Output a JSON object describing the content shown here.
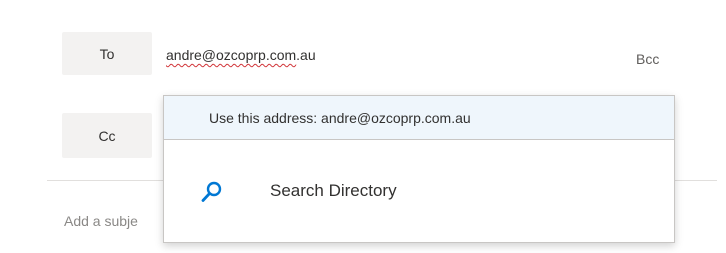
{
  "to_button": {
    "label": "To"
  },
  "cc_button": {
    "label": "Cc"
  },
  "to_field": {
    "value_spelled": "andre@ozcoprp.com",
    "value_suffix": ".au"
  },
  "bcc_link": {
    "label": "Bcc"
  },
  "subject": {
    "placeholder_visible": "Add a subje"
  },
  "suggestions": {
    "use_address_label": "Use this address: andre@ozcoprp.com.au",
    "search_directory_label": "Search Directory",
    "search_icon": "search-icon",
    "accent_color": "#0078d4"
  }
}
